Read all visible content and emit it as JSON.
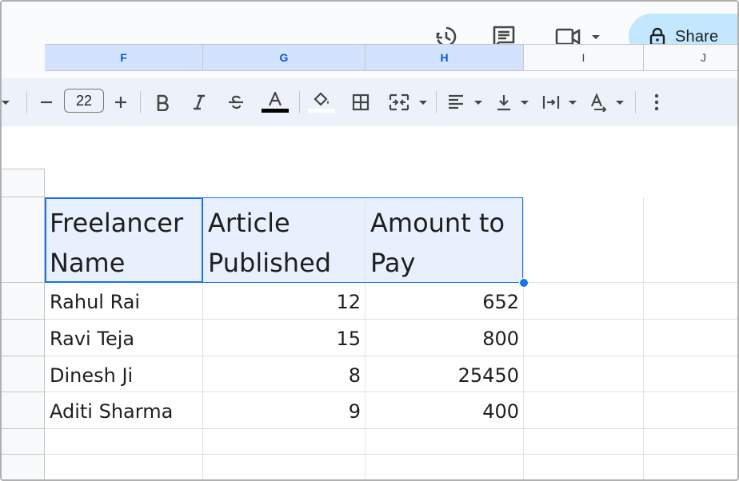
{
  "header": {
    "icons": [
      "history-icon",
      "comment-icon",
      "video-call-icon",
      "chevron-down-icon",
      "lock-icon"
    ],
    "share_label": "Share",
    "accent": "#c2e7ff"
  },
  "toolbar": {
    "font_size": "22",
    "text_color_bar": "#000000",
    "fill_color_bar": "#ffffff",
    "icons": [
      "minus-icon",
      "plus-icon",
      "bold-icon",
      "italic-icon",
      "strikethrough-icon",
      "text-color-icon",
      "fill-color-icon",
      "borders-icon",
      "merge-cells-icon",
      "horizontal-align-icon",
      "vertical-align-icon",
      "text-wrapping-icon",
      "text-rotation-icon",
      "more-options-icon"
    ]
  },
  "sheet": {
    "columns": [
      "F",
      "G",
      "H",
      "I",
      "J"
    ],
    "selected_columns": [
      "F",
      "G",
      "H"
    ],
    "header_row": [
      "Freelancer Name",
      "Article Published",
      "Amount to Pay"
    ],
    "rows": [
      [
        "Rahul Rai",
        "12",
        "652"
      ],
      [
        "Ravi Teja",
        "15",
        "800"
      ],
      [
        "Dinesh Ji",
        "8",
        "25450"
      ],
      [
        "Aditi Sharma",
        "9",
        "400"
      ]
    ],
    "selection_color": "#1a73e8"
  }
}
